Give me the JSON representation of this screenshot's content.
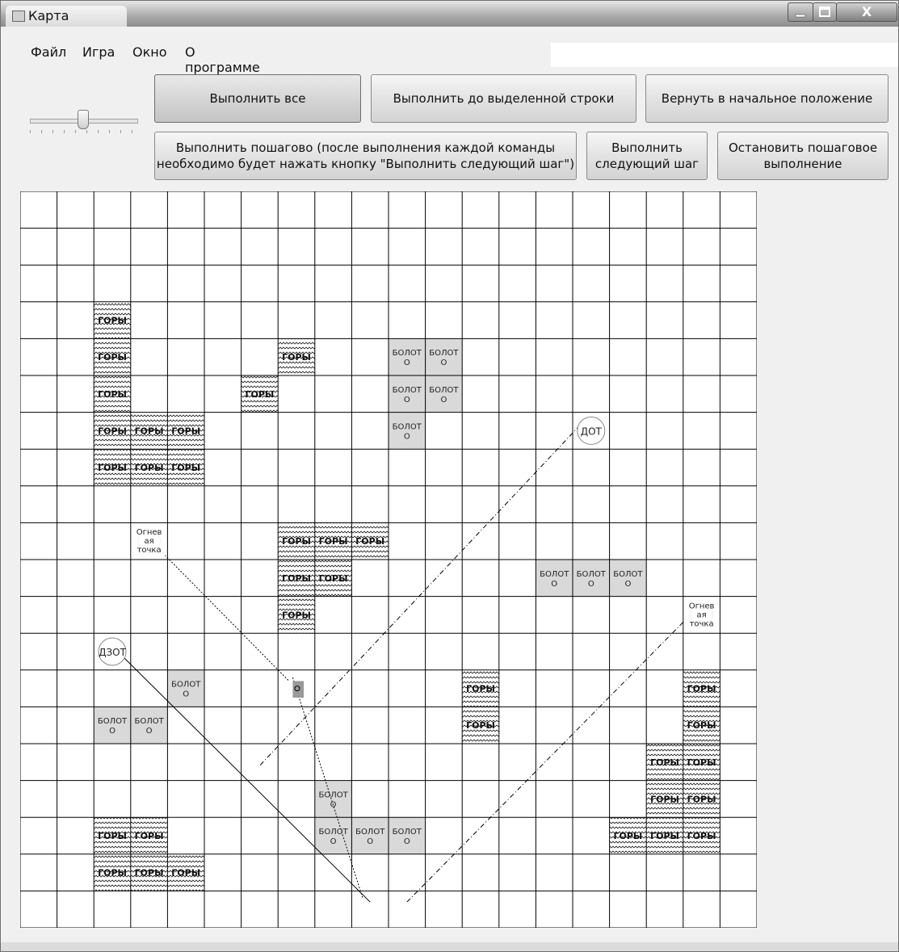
{
  "window": {
    "title": "Карта",
    "controls": {
      "minimize_icon": "minimize-icon",
      "maximize_icon": "maximize-icon",
      "close_glyph": "X"
    }
  },
  "menu": {
    "items": [
      "Файл",
      "Игра",
      "Окно",
      "О программе"
    ]
  },
  "speed_slider": {
    "level": 0.5
  },
  "toolbar": {
    "run_all": "Выполнить все",
    "run_to_selected": "Выполнить до выделенной строки",
    "reset": "Вернуть в начальное положение",
    "step_mode": [
      "Выполнить пошагово (после выполнения каждой команды",
      "необходимо будет нажать кнопку \"Выполнить следующий шаг\")"
    ],
    "next_step": [
      "Выполнить",
      "следующий шаг"
    ],
    "stop_step": [
      "Остановить пошаговое",
      "выполнение"
    ]
  },
  "map": {
    "columns": 20,
    "rows": 20,
    "mountain_label": "ГОРЫ",
    "swamp_label": [
      "БОЛОТ",
      "О"
    ],
    "mountains": [
      [
        2,
        3
      ],
      [
        2,
        4
      ],
      [
        2,
        5
      ],
      [
        2,
        6
      ],
      [
        3,
        6
      ],
      [
        4,
        6
      ],
      [
        2,
        7
      ],
      [
        3,
        7
      ],
      [
        4,
        7
      ],
      [
        7,
        4
      ],
      [
        6,
        5
      ],
      [
        7,
        9
      ],
      [
        8,
        9
      ],
      [
        9,
        9
      ],
      [
        7,
        10
      ],
      [
        8,
        10
      ],
      [
        7,
        11
      ],
      [
        12,
        13
      ],
      [
        12,
        14
      ],
      [
        18,
        13
      ],
      [
        18,
        14
      ],
      [
        17,
        15
      ],
      [
        18,
        15
      ],
      [
        17,
        16
      ],
      [
        18,
        16
      ],
      [
        16,
        17
      ],
      [
        17,
        17
      ],
      [
        18,
        17
      ],
      [
        2,
        17
      ],
      [
        3,
        17
      ],
      [
        2,
        18
      ],
      [
        3,
        18
      ],
      [
        4,
        18
      ]
    ],
    "swamps": [
      [
        10,
        4
      ],
      [
        11,
        4
      ],
      [
        10,
        5
      ],
      [
        11,
        5
      ],
      [
        10,
        6
      ],
      [
        14,
        10
      ],
      [
        15,
        10
      ],
      [
        16,
        10
      ],
      [
        4,
        13
      ],
      [
        2,
        14
      ],
      [
        3,
        14
      ],
      [
        8,
        16
      ],
      [
        8,
        17
      ],
      [
        9,
        17
      ],
      [
        10,
        17
      ]
    ],
    "markers": [
      {
        "label": "ДОТ",
        "col": 15,
        "row": 6
      },
      {
        "label": "ДЗОТ",
        "col": 2,
        "row": 12
      },
      {
        "label": [
          "Огнев",
          "ая",
          "точка"
        ],
        "col": 3,
        "row": 9
      },
      {
        "label": [
          "Огнев",
          "ая",
          "точка"
        ],
        "col": 18,
        "row": 11
      }
    ],
    "colors": {
      "grid": "#000000",
      "swamp": "#d9d9d9",
      "mountain_hatch": "#444444",
      "background": "#ffffff"
    }
  }
}
